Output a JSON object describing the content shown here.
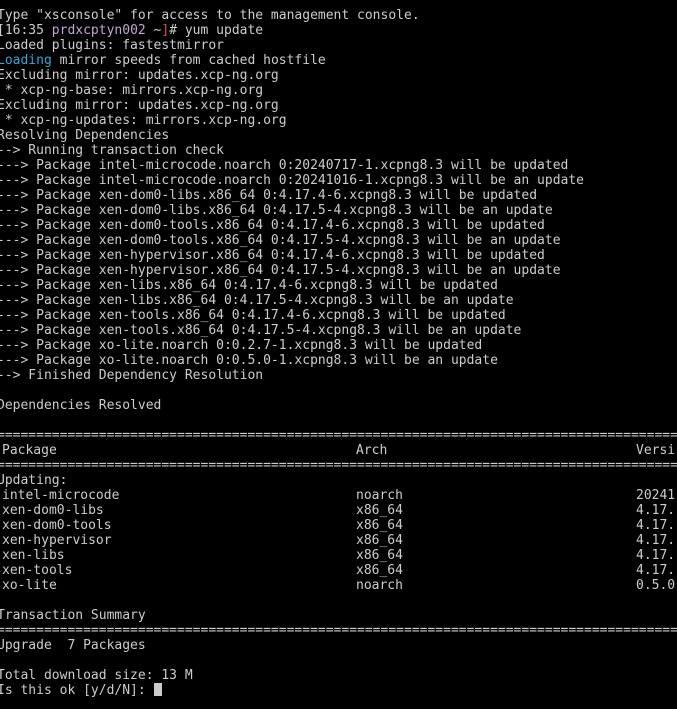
{
  "lines": {
    "l0": "Type \"xsconsole\" for access to the management console.",
    "prompt_time": "[16:35",
    "prompt_host": "prdxcptyn002",
    "prompt_dir": " ~",
    "prompt_mark": "]",
    "prompt_cmd": "# yum update",
    "l2": "Loaded plugins: fastestmirror",
    "loading_word": "Loading",
    "l3_rest": " mirror speeds from cached hostfile",
    "l4": "Excluding mirror: updates.xcp-ng.org",
    "l5": " * xcp-ng-base: mirrors.xcp-ng.org",
    "l6": "Excluding mirror: updates.xcp-ng.org",
    "l7": " * xcp-ng-updates: mirrors.xcp-ng.org",
    "l8": "Resolving Dependencies",
    "l9": "--> Running transaction check",
    "l10": "---> Package intel-microcode.noarch 0:20240717-1.xcpng8.3 will be updated",
    "l11": "---> Package intel-microcode.noarch 0:20241016-1.xcpng8.3 will be an update",
    "l12": "---> Package xen-dom0-libs.x86_64 0:4.17.4-6.xcpng8.3 will be updated",
    "l13": "---> Package xen-dom0-libs.x86_64 0:4.17.5-4.xcpng8.3 will be an update",
    "l14": "---> Package xen-dom0-tools.x86_64 0:4.17.4-6.xcpng8.3 will be updated",
    "l15": "---> Package xen-dom0-tools.x86_64 0:4.17.5-4.xcpng8.3 will be an update",
    "l16": "---> Package xen-hypervisor.x86_64 0:4.17.4-6.xcpng8.3 will be updated",
    "l17": "---> Package xen-hypervisor.x86_64 0:4.17.5-4.xcpng8.3 will be an update",
    "l18": "---> Package xen-libs.x86_64 0:4.17.4-6.xcpng8.3 will be updated",
    "l19": "---> Package xen-libs.x86_64 0:4.17.5-4.xcpng8.3 will be an update",
    "l20": "---> Package xen-tools.x86_64 0:4.17.4-6.xcpng8.3 will be updated",
    "l21": "---> Package xen-tools.x86_64 0:4.17.5-4.xcpng8.3 will be an update",
    "l22": "---> Package xo-lite.noarch 0:0.2.7-1.xcpng8.3 will be updated",
    "l23": "---> Package xo-lite.noarch 0:0.5.0-1.xcpng8.3 will be an update",
    "l24": "--> Finished Dependency Resolution",
    "l26": "Dependencies Resolved",
    "sep_double": "================================================================================================",
    "l33": "Updating:",
    "l42": "Transaction Summary",
    "l44": "Upgrade  7 Packages",
    "l46": "Total download size: 13 M",
    "l47": "Is this ok [y/d/N]: "
  },
  "table": {
    "headers": {
      "package": "Package",
      "arch": "Arch",
      "version": "Versi"
    },
    "rows": [
      {
        "package": "intel-microcode",
        "arch": "noarch",
        "version": "20241"
      },
      {
        "package": "xen-dom0-libs",
        "arch": "x86_64",
        "version": "4.17."
      },
      {
        "package": "xen-dom0-tools",
        "arch": "x86_64",
        "version": "4.17."
      },
      {
        "package": "xen-hypervisor",
        "arch": "x86_64",
        "version": "4.17."
      },
      {
        "package": "xen-libs",
        "arch": "x86_64",
        "version": "4.17."
      },
      {
        "package": "xen-tools",
        "arch": "x86_64",
        "version": "4.17."
      },
      {
        "package": "xo-lite",
        "arch": "noarch",
        "version": "0.5.0"
      }
    ]
  },
  "colors": {
    "background": "#000000",
    "foreground": "#cccccc",
    "host": "#c3a3d8",
    "prompt_mark": "#e05050",
    "loading_word": "#3aa6d8"
  }
}
